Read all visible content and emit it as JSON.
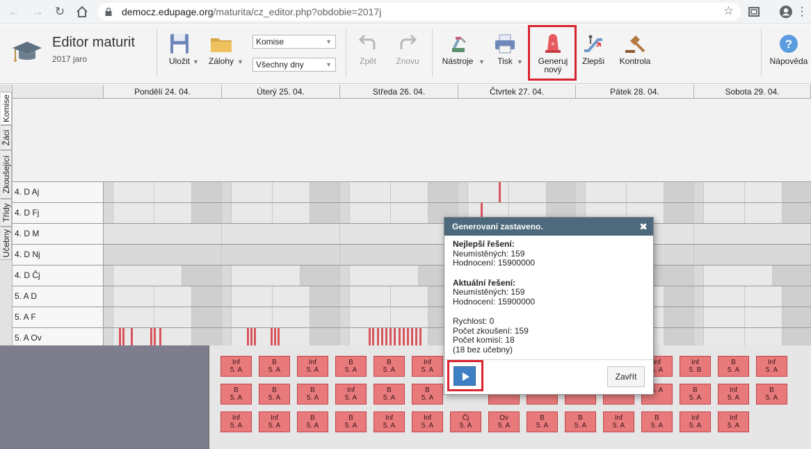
{
  "browser": {
    "url_host": "democz.edupage.org",
    "url_path": "/maturita/cz_editor.php?obdobie=2017j"
  },
  "app": {
    "title": "Editor maturit",
    "subtitle": "2017 jaro"
  },
  "toolbar": {
    "save_label": "Uložit",
    "backups_label": "Zálohy",
    "select_type_value": "Komise",
    "select_days_value": "Všechny dny",
    "undo_label": "Zpět",
    "redo_label": "Znovu",
    "tools_label": "Nástroje",
    "print_label": "Tisk",
    "generate_label_line1": "Generuj",
    "generate_label_line2": "nový",
    "improve_label": "Zlepši",
    "check_label": "Kontrola",
    "help_label": "Nápověda"
  },
  "side_tabs": [
    "Komise",
    "Žáci",
    "Zkoušející",
    "Třídy",
    "Učebny"
  ],
  "days": [
    "Pondělí 24. 04.",
    "Úterý 25. 04.",
    "Středa 26. 04.",
    "Čtvrtek 27. 04.",
    "Pátek 28. 04.",
    "Sobota 29. 04."
  ],
  "rows": [
    "4. D Aj",
    "4. D Fj",
    "4. D M",
    "4. D Nj",
    "4. D Čj",
    "5. A D",
    "5. A F",
    "5. A Ov"
  ],
  "chips": [
    [
      "Inf|5. A",
      "B|5. A",
      "Inf|5. A",
      "B|5. A",
      "B|5. A",
      "Inf|5. A",
      "",
      "",
      "",
      "",
      "",
      "Inf|5. A",
      "Inf|5. B",
      "B|5. A",
      "Inf|5. A"
    ],
    [
      "B|5. A",
      "B|5. A",
      "B|5. A",
      "Inf|5. A",
      "B|5. A",
      "B|5. A",
      "",
      "|5. A",
      "|5. A",
      "|5. A",
      "|5. A",
      "|5. A",
      "B|5. A",
      "Inf|5. A",
      "B|5. A"
    ],
    [
      "Inf|5. A",
      "Inf|5. A",
      "B|5. A",
      "B|5. A",
      "Inf|5. A",
      "Inf|5. A",
      "Čj|5. A",
      "Ov|5. A",
      "B|5. A",
      "B|5. A",
      "Inf|5. A",
      "B|5. A",
      "Inf|5. A",
      "Inf|5. A"
    ]
  ],
  "dialog": {
    "title": "Generovaní zastaveno.",
    "best_heading": "Nejlepší řešení:",
    "best_unplaced": "Neumístěných: 159",
    "best_rating": "Hodnocení: 15900000",
    "current_heading": "Aktuální řešení:",
    "current_unplaced": "Neumístěných: 159",
    "current_rating": "Hodnocení: 15900000",
    "speed": "Rychlost: 0",
    "exam_count": "Počet zkoušení: 159",
    "committee_count": "Počet komisí: 18",
    "no_room": "(18 bez učebny)",
    "close_label": "Zavřít"
  },
  "colors": {
    "highlight": "#d9232e",
    "dialog_header": "#4d6a7c",
    "chip": "#e87a7c",
    "play": "#3f7fc4"
  }
}
